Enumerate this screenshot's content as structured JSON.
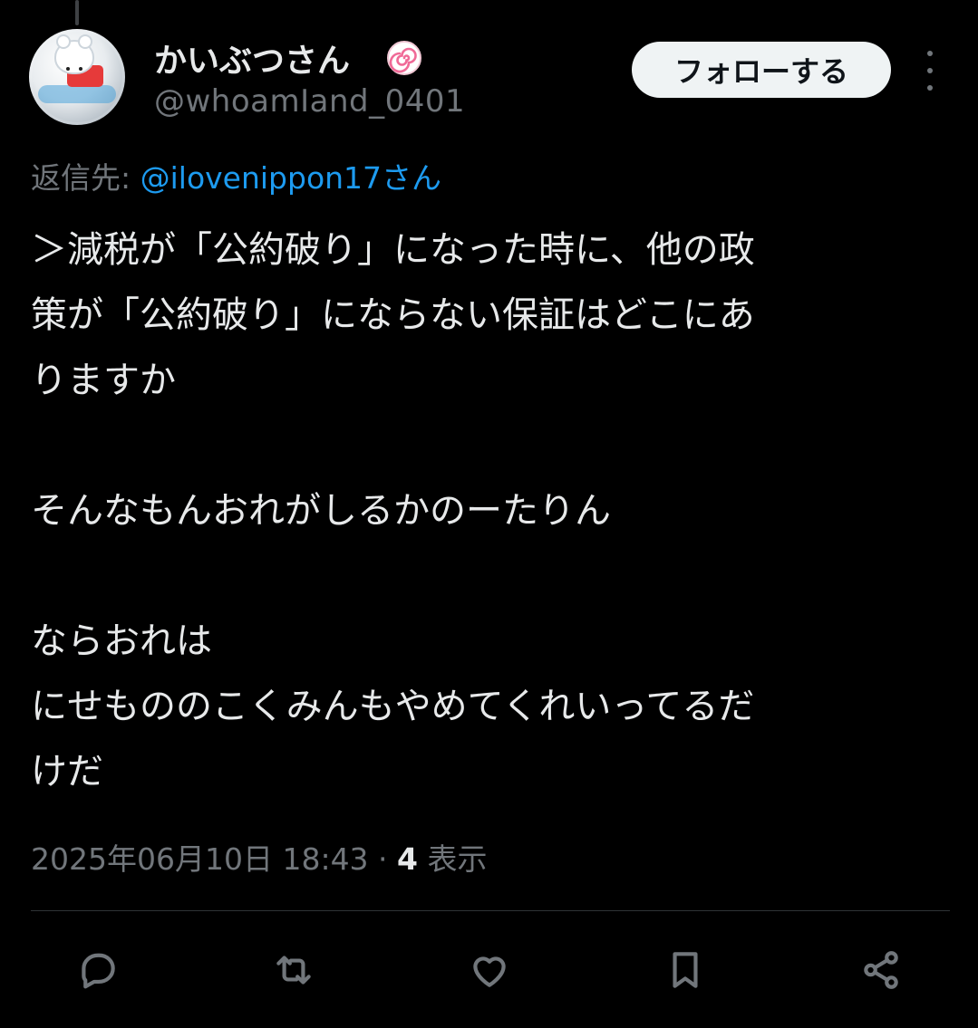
{
  "author": {
    "display_name": "かいぶつさん",
    "handle": "@whoamIand_0401",
    "badge_icon": "naruto-spiral-icon"
  },
  "follow_button_label": "フォローする",
  "reply": {
    "prefix": "返信先: ",
    "target": "@ilovenippon17さん"
  },
  "tweet_text": {
    "line1": "＞減税が「公約破り」になった時に、他の政",
    "line2": "策が「公約破り」にならない保証はどこにあ",
    "line3": "りますか",
    "line4": "そんなもんおれがしるかのーたりん",
    "line5": "ならおれは",
    "line6": "にせもののこくみんもやめてくれいってるだ",
    "line7": "けだ"
  },
  "meta": {
    "timestamp": "2025年06月10日 18:43",
    "separator": " · ",
    "view_count": "4",
    "view_label": " 表示"
  },
  "actions": [
    "reply-icon",
    "retweet-icon",
    "like-icon",
    "bookmark-icon",
    "share-icon"
  ],
  "colors": {
    "background": "#000000",
    "text": "#e7e9ea",
    "muted": "#71767b",
    "link": "#1d9bf0",
    "button_bg": "#eff3f4"
  }
}
